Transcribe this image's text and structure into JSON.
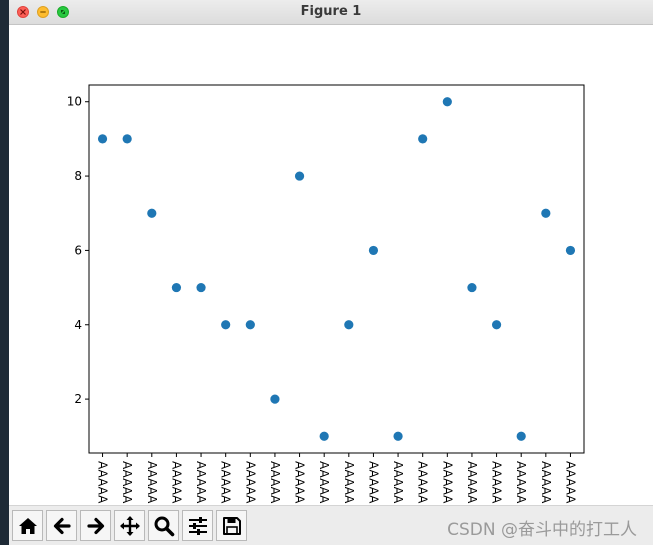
{
  "window": {
    "title": "Figure 1"
  },
  "chart_data": {
    "type": "scatter",
    "title": "",
    "xlabel": "",
    "ylabel": "",
    "x": [
      "AAAAA",
      "AAAAA",
      "AAAAA",
      "AAAAA",
      "AAAAA",
      "AAAAA",
      "AAAAA",
      "AAAAA",
      "AAAAA",
      "AAAAA",
      "AAAAA",
      "AAAAA",
      "AAAAA",
      "AAAAA",
      "AAAAA",
      "AAAAA",
      "AAAAA",
      "AAAAA",
      "AAAAA",
      "AAAAA"
    ],
    "y": [
      9,
      9,
      7,
      5,
      5,
      4,
      4,
      2,
      8,
      1,
      4,
      6,
      1,
      9,
      10,
      5,
      4,
      1,
      7,
      6
    ],
    "ylim": [
      0.55,
      10.45
    ],
    "yticks": [
      2,
      4,
      6,
      8,
      10
    ],
    "grid": false,
    "marker_color": "#1f77b4"
  },
  "toolbar": {
    "buttons": [
      {
        "name": "home-button",
        "icon": "home-icon"
      },
      {
        "name": "back-button",
        "icon": "arrow-left-icon"
      },
      {
        "name": "forward-button",
        "icon": "arrow-right-icon"
      },
      {
        "name": "pan-button",
        "icon": "move-icon"
      },
      {
        "name": "zoom-button",
        "icon": "magnifier-icon"
      },
      {
        "name": "configure-subplots-button",
        "icon": "sliders-icon"
      },
      {
        "name": "save-button",
        "icon": "floppy-disk-icon"
      }
    ]
  },
  "watermark": "CSDN @奋斗中的打工人"
}
